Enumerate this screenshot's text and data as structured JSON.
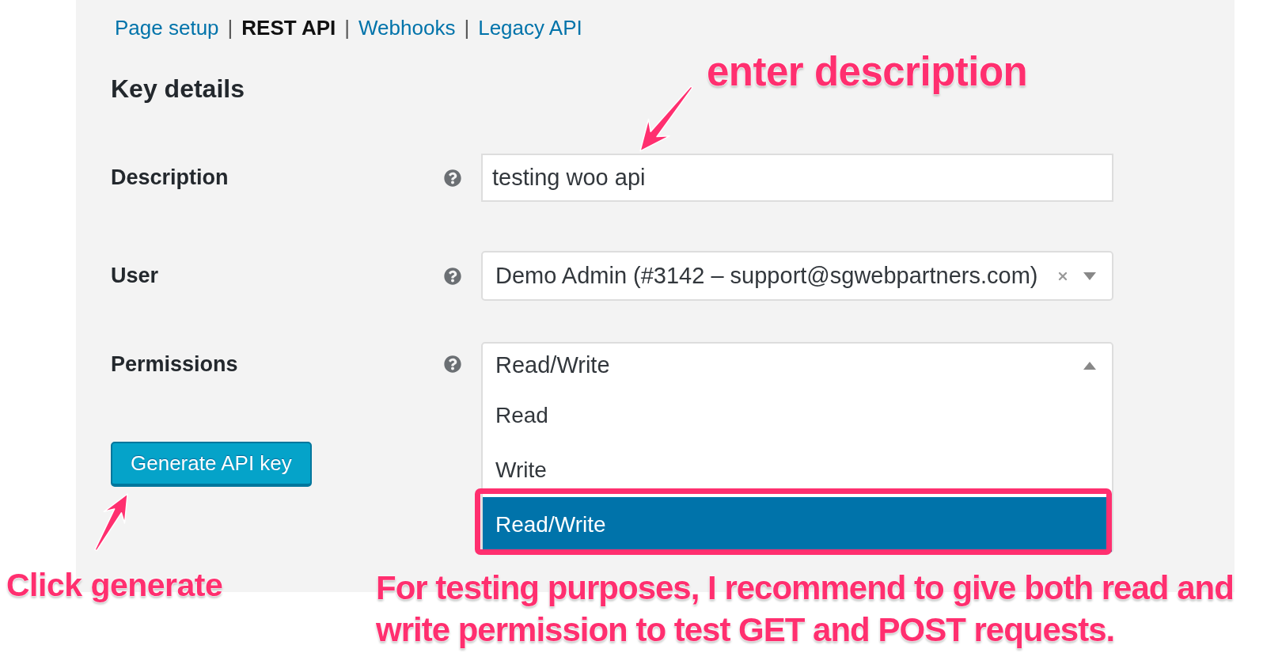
{
  "nav": [
    {
      "label": "Page setup",
      "selected": false
    },
    {
      "separator": "|",
      "label": "REST API",
      "selected": true
    },
    {
      "separator": "|",
      "label": "Webhooks",
      "selected": false
    },
    {
      "separator": "|",
      "label": "Legacy API",
      "selected": false
    }
  ],
  "heading": "Key details",
  "fields": [
    {
      "kind": "text",
      "label": "Description",
      "value": "testing woo api"
    },
    {
      "kind": "select",
      "label": "User",
      "value": "Demo Admin (#3142 – support@sgwebpartners.com)",
      "clear_button": true,
      "expanded": false
    },
    {
      "kind": "select",
      "label": "Permissions",
      "value": "Read/Write",
      "expanded": true,
      "options": [
        {
          "label": "Read",
          "selected": false
        },
        {
          "label": "Write",
          "selected": false
        },
        {
          "label": "Read/Write",
          "selected": true
        }
      ]
    }
  ],
  "generate_button": "Generate API key",
  "annotations": {
    "description_hint": "enter description",
    "generate_hint": "Click generate",
    "permissions_hint": "For testing purposes, I recommend to give both read and write permission to test GET and POST requests."
  }
}
